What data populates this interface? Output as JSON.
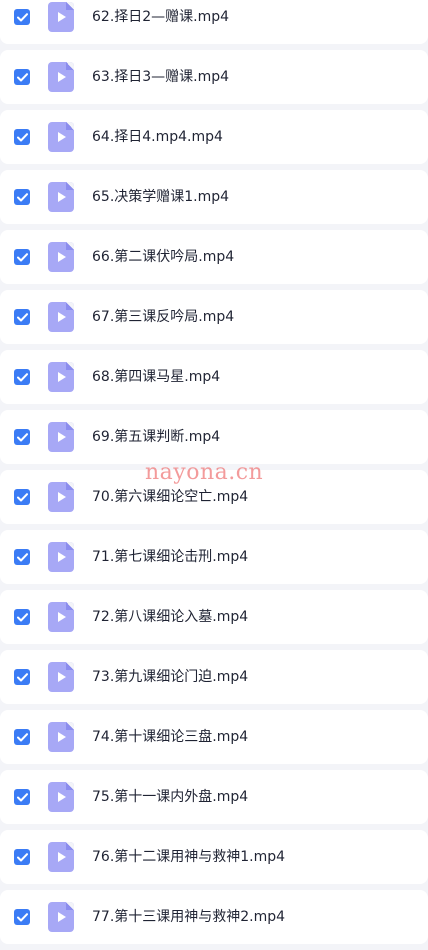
{
  "colors": {
    "background": "#f3f4f8",
    "row": "#ffffff",
    "checkbox_checked": "#3b7cf5",
    "file_icon": "#a7a8f6",
    "text": "#1f2333",
    "watermark": "#f07a7a"
  },
  "files": [
    {
      "name": "62.择日2—赠课.mp4",
      "checked": true,
      "icon": "video-file-icon"
    },
    {
      "name": "63.择日3—赠课.mp4",
      "checked": true,
      "icon": "video-file-icon"
    },
    {
      "name": "64.择日4.mp4.mp4",
      "checked": true,
      "icon": "video-file-icon"
    },
    {
      "name": "65.决策学赠课1.mp4",
      "checked": true,
      "icon": "video-file-icon"
    },
    {
      "name": "66.第二课伏吟局.mp4",
      "checked": true,
      "icon": "video-file-icon"
    },
    {
      "name": "67.第三课反吟局.mp4",
      "checked": true,
      "icon": "video-file-icon"
    },
    {
      "name": "68.第四课马星.mp4",
      "checked": true,
      "icon": "video-file-icon"
    },
    {
      "name": "69.第五课判断.mp4",
      "checked": true,
      "icon": "video-file-icon"
    },
    {
      "name": "70.第六课细论空亡.mp4",
      "checked": true,
      "icon": "video-file-icon"
    },
    {
      "name": "71.第七课细论击刑.mp4",
      "checked": true,
      "icon": "video-file-icon"
    },
    {
      "name": "72.第八课细论入墓.mp4",
      "checked": true,
      "icon": "video-file-icon"
    },
    {
      "name": "73.第九课细论门迫.mp4",
      "checked": true,
      "icon": "video-file-icon"
    },
    {
      "name": "74.第十课细论三盘.mp4",
      "checked": true,
      "icon": "video-file-icon"
    },
    {
      "name": "75.第十一课内外盘.mp4",
      "checked": true,
      "icon": "video-file-icon"
    },
    {
      "name": "76.第十二课用神与救神1.mp4",
      "checked": true,
      "icon": "video-file-icon"
    },
    {
      "name": "77.第十三课用神与救神2.mp4",
      "checked": true,
      "icon": "video-file-icon"
    }
  ],
  "watermark": "nayona.cn"
}
